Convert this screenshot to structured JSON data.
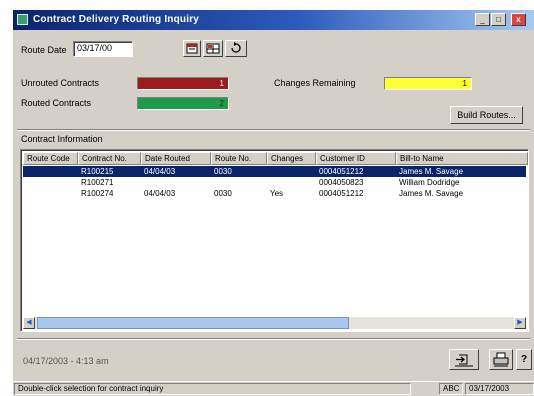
{
  "window": {
    "title": "Contract Delivery Routing Inquiry",
    "minimize_glyph": "_",
    "maximize_glyph": "□",
    "close_glyph": "x"
  },
  "route_date": {
    "label": "Route Date",
    "value": "03/17/00"
  },
  "counters": {
    "unrouted": {
      "label": "Unrouted Contracts",
      "value": "1",
      "color": "#9b1c1c"
    },
    "routed": {
      "label": "Routed Contracts",
      "value": "2",
      "color": "#1f9a4a"
    },
    "changes": {
      "label": "Changes Remaining",
      "value": "1",
      "color": "#ffff33"
    }
  },
  "build_routes_label": "Build Routes...",
  "section_label": "Contract Information",
  "columns": [
    "Route Code",
    "Contract No.",
    "Date Routed",
    "Route No.",
    "Changes",
    "Customer ID",
    "Bill-to Name"
  ],
  "rows": [
    {
      "route_code": "",
      "contract_no": "R100215",
      "date_routed": "04/04/03",
      "route_no": "0030",
      "changes": "",
      "customer_id": "0004051212",
      "bill_to": "James M. Savage",
      "selected": true
    },
    {
      "route_code": "",
      "contract_no": "R100271",
      "date_routed": "",
      "route_no": "",
      "changes": "",
      "customer_id": "0004050823",
      "bill_to": "William Dodridge",
      "selected": false
    },
    {
      "route_code": "",
      "contract_no": "R100274",
      "date_routed": "04/04/03",
      "route_no": "0030",
      "changes": "Yes",
      "customer_id": "0004051212",
      "bill_to": "James M. Savage",
      "selected": false
    }
  ],
  "footer": {
    "timestamp": "04/17/2003 - 4:13 am"
  },
  "status": {
    "message": "Double-click selection for contract inquiry",
    "mode": "ABC",
    "date": "03/17/2003"
  },
  "icons": [
    "calendar-icon",
    "grid-icon",
    "refresh-icon",
    "exit-icon",
    "print-icon",
    "help-icon"
  ]
}
